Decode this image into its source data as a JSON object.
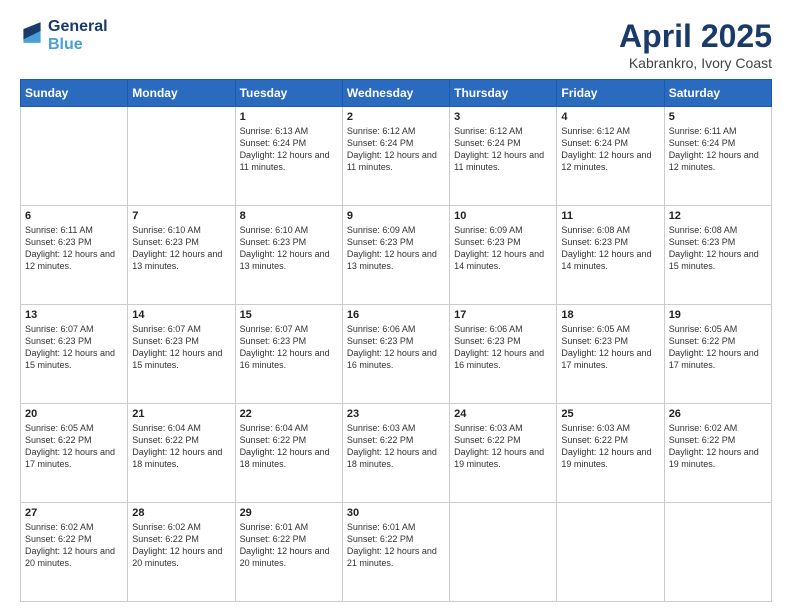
{
  "header": {
    "logo_line1": "General",
    "logo_line2": "Blue",
    "month": "April 2025",
    "location": "Kabrankro, Ivory Coast"
  },
  "weekdays": [
    "Sunday",
    "Monday",
    "Tuesday",
    "Wednesday",
    "Thursday",
    "Friday",
    "Saturday"
  ],
  "weeks": [
    [
      {
        "day": "",
        "info": ""
      },
      {
        "day": "",
        "info": ""
      },
      {
        "day": "1",
        "info": "Sunrise: 6:13 AM\nSunset: 6:24 PM\nDaylight: 12 hours and 11 minutes."
      },
      {
        "day": "2",
        "info": "Sunrise: 6:12 AM\nSunset: 6:24 PM\nDaylight: 12 hours and 11 minutes."
      },
      {
        "day": "3",
        "info": "Sunrise: 6:12 AM\nSunset: 6:24 PM\nDaylight: 12 hours and 11 minutes."
      },
      {
        "day": "4",
        "info": "Sunrise: 6:12 AM\nSunset: 6:24 PM\nDaylight: 12 hours and 12 minutes."
      },
      {
        "day": "5",
        "info": "Sunrise: 6:11 AM\nSunset: 6:24 PM\nDaylight: 12 hours and 12 minutes."
      }
    ],
    [
      {
        "day": "6",
        "info": "Sunrise: 6:11 AM\nSunset: 6:23 PM\nDaylight: 12 hours and 12 minutes."
      },
      {
        "day": "7",
        "info": "Sunrise: 6:10 AM\nSunset: 6:23 PM\nDaylight: 12 hours and 13 minutes."
      },
      {
        "day": "8",
        "info": "Sunrise: 6:10 AM\nSunset: 6:23 PM\nDaylight: 12 hours and 13 minutes."
      },
      {
        "day": "9",
        "info": "Sunrise: 6:09 AM\nSunset: 6:23 PM\nDaylight: 12 hours and 13 minutes."
      },
      {
        "day": "10",
        "info": "Sunrise: 6:09 AM\nSunset: 6:23 PM\nDaylight: 12 hours and 14 minutes."
      },
      {
        "day": "11",
        "info": "Sunrise: 6:08 AM\nSunset: 6:23 PM\nDaylight: 12 hours and 14 minutes."
      },
      {
        "day": "12",
        "info": "Sunrise: 6:08 AM\nSunset: 6:23 PM\nDaylight: 12 hours and 15 minutes."
      }
    ],
    [
      {
        "day": "13",
        "info": "Sunrise: 6:07 AM\nSunset: 6:23 PM\nDaylight: 12 hours and 15 minutes."
      },
      {
        "day": "14",
        "info": "Sunrise: 6:07 AM\nSunset: 6:23 PM\nDaylight: 12 hours and 15 minutes."
      },
      {
        "day": "15",
        "info": "Sunrise: 6:07 AM\nSunset: 6:23 PM\nDaylight: 12 hours and 16 minutes."
      },
      {
        "day": "16",
        "info": "Sunrise: 6:06 AM\nSunset: 6:23 PM\nDaylight: 12 hours and 16 minutes."
      },
      {
        "day": "17",
        "info": "Sunrise: 6:06 AM\nSunset: 6:23 PM\nDaylight: 12 hours and 16 minutes."
      },
      {
        "day": "18",
        "info": "Sunrise: 6:05 AM\nSunset: 6:23 PM\nDaylight: 12 hours and 17 minutes."
      },
      {
        "day": "19",
        "info": "Sunrise: 6:05 AM\nSunset: 6:22 PM\nDaylight: 12 hours and 17 minutes."
      }
    ],
    [
      {
        "day": "20",
        "info": "Sunrise: 6:05 AM\nSunset: 6:22 PM\nDaylight: 12 hours and 17 minutes."
      },
      {
        "day": "21",
        "info": "Sunrise: 6:04 AM\nSunset: 6:22 PM\nDaylight: 12 hours and 18 minutes."
      },
      {
        "day": "22",
        "info": "Sunrise: 6:04 AM\nSunset: 6:22 PM\nDaylight: 12 hours and 18 minutes."
      },
      {
        "day": "23",
        "info": "Sunrise: 6:03 AM\nSunset: 6:22 PM\nDaylight: 12 hours and 18 minutes."
      },
      {
        "day": "24",
        "info": "Sunrise: 6:03 AM\nSunset: 6:22 PM\nDaylight: 12 hours and 19 minutes."
      },
      {
        "day": "25",
        "info": "Sunrise: 6:03 AM\nSunset: 6:22 PM\nDaylight: 12 hours and 19 minutes."
      },
      {
        "day": "26",
        "info": "Sunrise: 6:02 AM\nSunset: 6:22 PM\nDaylight: 12 hours and 19 minutes."
      }
    ],
    [
      {
        "day": "27",
        "info": "Sunrise: 6:02 AM\nSunset: 6:22 PM\nDaylight: 12 hours and 20 minutes."
      },
      {
        "day": "28",
        "info": "Sunrise: 6:02 AM\nSunset: 6:22 PM\nDaylight: 12 hours and 20 minutes."
      },
      {
        "day": "29",
        "info": "Sunrise: 6:01 AM\nSunset: 6:22 PM\nDaylight: 12 hours and 20 minutes."
      },
      {
        "day": "30",
        "info": "Sunrise: 6:01 AM\nSunset: 6:22 PM\nDaylight: 12 hours and 21 minutes."
      },
      {
        "day": "",
        "info": ""
      },
      {
        "day": "",
        "info": ""
      },
      {
        "day": "",
        "info": ""
      }
    ]
  ]
}
